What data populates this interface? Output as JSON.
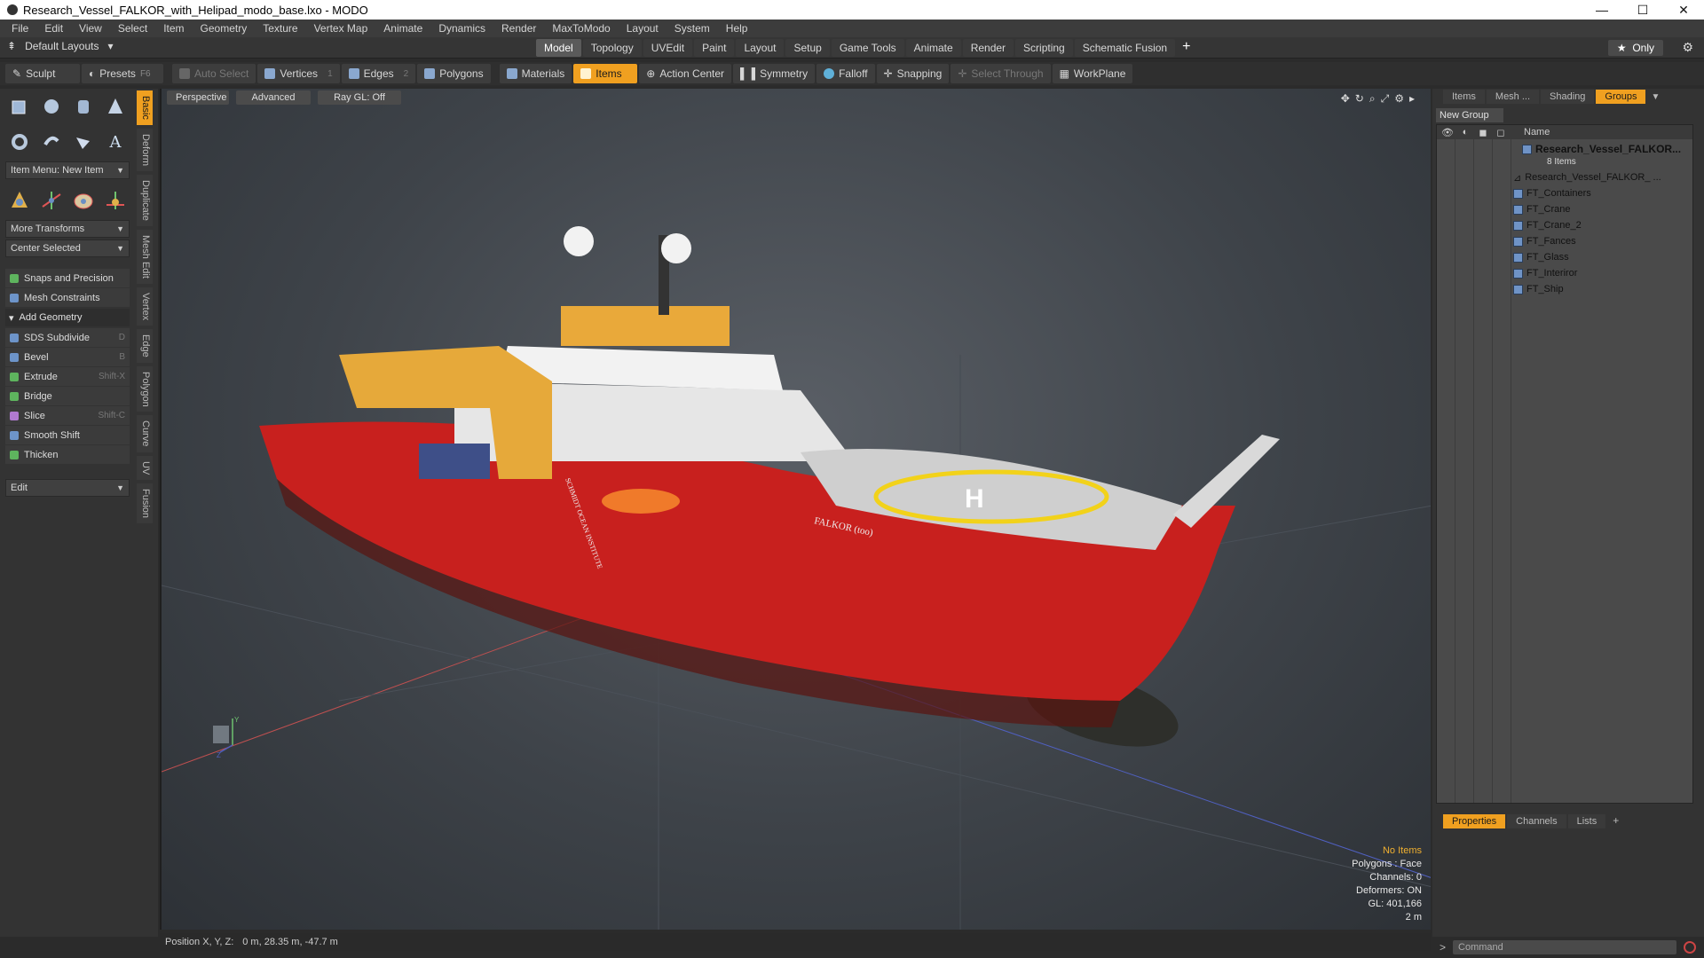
{
  "window": {
    "title": "Research_Vessel_FALKOR_with_Helipad_modo_base.lxo - MODO",
    "controls": [
      "—",
      "☐",
      "✕"
    ]
  },
  "menu": [
    "File",
    "Edit",
    "View",
    "Select",
    "Item",
    "Geometry",
    "Texture",
    "Vertex Map",
    "Animate",
    "Dynamics",
    "Render",
    "MaxToModo",
    "Layout",
    "System",
    "Help"
  ],
  "layout_bar": {
    "default_layouts": "Default Layouts",
    "tabs": [
      "Model",
      "Topology",
      "UVEdit",
      "Paint",
      "Layout",
      "Setup",
      "Game Tools",
      "Animate",
      "Render",
      "Scripting",
      "Schematic Fusion"
    ],
    "active_tab": "Model",
    "only_label": "Only"
  },
  "toolbar": {
    "sculpt": "Sculpt",
    "presets": "Presets",
    "presets_shortcut": "F6",
    "auto_select": "Auto Select",
    "vertices": "Vertices",
    "vertices_num": "1",
    "edges": "Edges",
    "edges_num": "2",
    "polygons": "Polygons",
    "materials": "Materials",
    "items": "Items",
    "action_center": "Action Center",
    "symmetry": "Symmetry",
    "falloff": "Falloff",
    "snapping": "Snapping",
    "select_through": "Select Through",
    "workplane": "WorkPlane"
  },
  "left_panel": {
    "item_menu": "Item Menu: New Item",
    "more_transforms": "More Transforms",
    "center_selected": "Center Selected",
    "snaps": "Snaps and Precision",
    "mesh_constraints": "Mesh Constraints",
    "add_geometry": "Add Geometry",
    "tools": [
      {
        "label": "SDS Subdivide",
        "shortcut": "D"
      },
      {
        "label": "Bevel",
        "shortcut": "B"
      },
      {
        "label": "Extrude",
        "shortcut": "Shift-X"
      },
      {
        "label": "Bridge",
        "shortcut": ""
      },
      {
        "label": "Slice",
        "shortcut": "Shift-C"
      },
      {
        "label": "Smooth Shift",
        "shortcut": ""
      },
      {
        "label": "Thicken",
        "shortcut": ""
      }
    ],
    "edit": "Edit",
    "vertical_tabs": [
      "Basic",
      "Deform",
      "Duplicate",
      "Mesh Edit",
      "Vertex",
      "Edge",
      "Polygon",
      "Curve",
      "UV",
      "Fusion"
    ]
  },
  "viewport": {
    "perspective": "Perspective",
    "advanced": "Advanced",
    "raygl": "Ray GL: Off",
    "info": {
      "no_items": "No Items",
      "polygons": "Polygons : Face",
      "channels": "Channels: 0",
      "deformers": "Deformers: ON",
      "gl": "GL: 401,166",
      "scale": "2 m"
    },
    "ship_name": "FALKOR (too)",
    "institute": "SCHMIDT OCEAN INSTITUTE",
    "axis_y": "Y",
    "axis_z": "Z"
  },
  "status": {
    "position_label": "Position X, Y, Z:",
    "position_value": "0 m, 28.35 m, -47.7 m"
  },
  "right_panel": {
    "tabs": [
      "Items",
      "Mesh ...",
      "Shading",
      "Groups"
    ],
    "active_tab": "Groups",
    "new_group": "New Group",
    "name_header": "Name",
    "root": "Research_Vessel_FALKOR...",
    "root_count": "8 Items",
    "children": [
      "Research_Vessel_FALKOR_ ...",
      "FT_Containers",
      "FT_Crane",
      "FT_Crane_2",
      "FT_Fances",
      "FT_Glass",
      "FT_Interiror",
      "FT_Ship"
    ],
    "bottom_tabs": [
      "Properties",
      "Channels",
      "Lists"
    ],
    "bottom_active": "Properties",
    "command_placeholder": "Command"
  },
  "colors": {
    "accent": "#f0a020",
    "hull_red": "#c8201e",
    "helipad_yellow": "#f2d21a",
    "bulb_dark": "#2e2f2b"
  }
}
